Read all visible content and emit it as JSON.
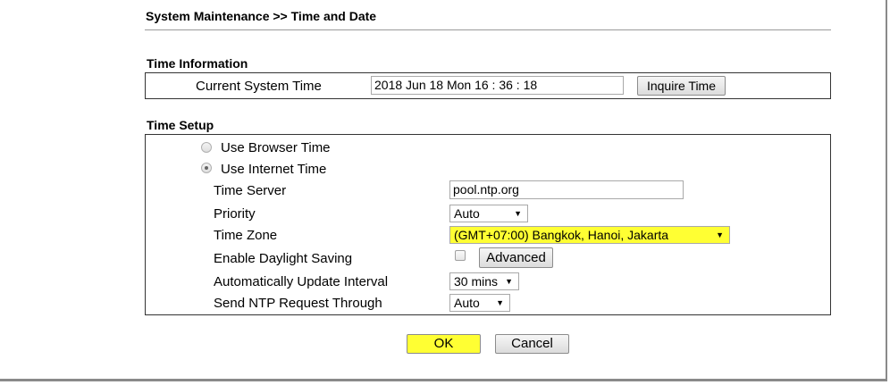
{
  "header": {
    "title": "System Maintenance >> Time and Date"
  },
  "time_information": {
    "section_title": "Time Information",
    "current_time_label": "Current System Time",
    "current_time_value": "2018 Jun 18 Mon 16 : 36 : 18",
    "inquire_button": "Inquire Time"
  },
  "time_setup": {
    "section_title": "Time Setup",
    "use_browser_time_label": "Use Browser Time",
    "use_internet_time_label": "Use Internet Time",
    "selected_mode": "Use Internet Time",
    "time_server_label": "Time Server",
    "time_server_value": "pool.ntp.org",
    "priority_label": "Priority",
    "priority_value": "Auto",
    "time_zone_label": "Time Zone",
    "time_zone_value": "(GMT+07:00) Bangkok, Hanoi, Jakarta",
    "daylight_saving_label": "Enable Daylight Saving",
    "daylight_saving_checked": false,
    "advanced_button": "Advanced",
    "update_interval_label": "Automatically Update Interval",
    "update_interval_value": "30 mins",
    "ntp_request_label": "Send NTP Request Through",
    "ntp_request_value": "Auto"
  },
  "footer": {
    "ok_button": "OK",
    "cancel_button": "Cancel"
  },
  "colors": {
    "highlight": "#ffff33",
    "border": "#333333"
  },
  "icons": {
    "dropdown": "triangle-down-icon"
  }
}
